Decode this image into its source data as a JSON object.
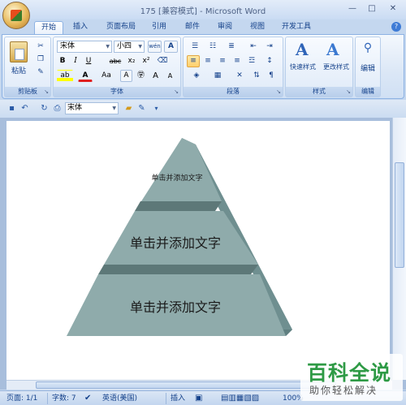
{
  "window": {
    "title": "175 [兼容模式] - Microsoft Word",
    "controls": [
      "—",
      "□",
      "✕"
    ]
  },
  "tabs": [
    "开始",
    "插入",
    "页面布局",
    "引用",
    "邮件",
    "审阅",
    "视图",
    "开发工具"
  ],
  "active_tab": "开始",
  "ribbon": {
    "clipboard": {
      "label": "剪贴板",
      "paste": "粘贴"
    },
    "font": {
      "label": "字体",
      "name": "宋体",
      "size": "小四",
      "bold": "B",
      "italic": "I",
      "underline": "U",
      "strike": "abc",
      "sub": "x₂",
      "sup": "x²",
      "case": "Aa",
      "grow": "A",
      "shrink": "A",
      "char_border": "A",
      "phonetic": "wén",
      "font_color": "A",
      "highlight": "ab"
    },
    "paragraph": {
      "label": "段落"
    },
    "styles": {
      "label": "样式",
      "quick": "快速样式",
      "change": "更改样式"
    },
    "editing": {
      "label": "编辑",
      "edit": "编辑"
    }
  },
  "qat": {
    "font": "宋体"
  },
  "document": {
    "pyramid": [
      {
        "text": "单击并添加文字"
      },
      {
        "text": "单击并添加文字"
      },
      {
        "text": "单击并添加文字"
      }
    ],
    "colors": {
      "face": "#8fabab",
      "side": "#6f8f90",
      "band": "#5d7878"
    }
  },
  "status": {
    "page": "页面: 1/1",
    "words": "字数: 7",
    "lang": "英语(美国)",
    "mode": "插入",
    "zoom": "100%"
  },
  "watermark": {
    "title": "百科全说",
    "subtitle": "助你轻松解决"
  }
}
